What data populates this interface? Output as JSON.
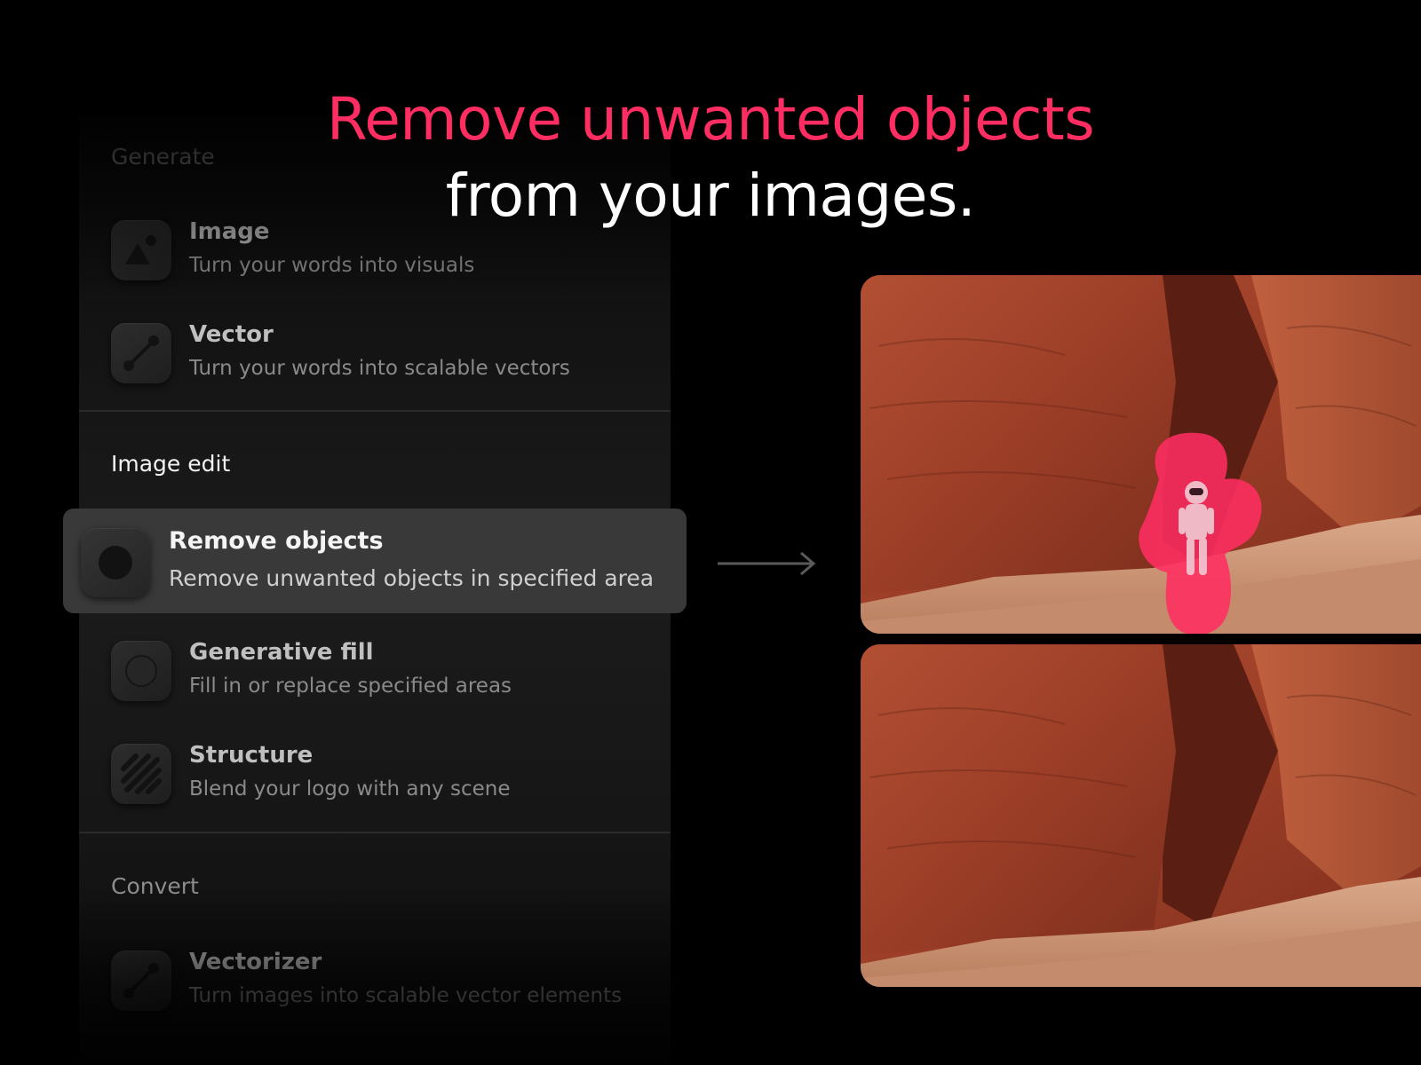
{
  "headline": {
    "line1": "Remove unwanted objects",
    "line2": "from your images."
  },
  "menu": {
    "sections": [
      {
        "label": "Generate",
        "items": [
          {
            "title": "Image",
            "description": "Turn your words into visuals",
            "icon": "image-icon"
          },
          {
            "title": "Vector",
            "description": "Turn your words into scalable vectors",
            "icon": "vector-pen-icon"
          }
        ]
      },
      {
        "label": "Image edit",
        "items": [
          {
            "title": "Remove objects",
            "description": "Remove unwanted objects in specified area",
            "icon": "remove-objects-icon",
            "selected": true
          },
          {
            "title": "Generative fill",
            "description": "Fill in or replace specified areas",
            "icon": "generative-fill-icon"
          },
          {
            "title": "Structure",
            "description": "Blend your logo with any scene",
            "icon": "structure-stripes-icon"
          }
        ]
      },
      {
        "label": "Convert",
        "items": [
          {
            "title": "Vectorizer",
            "description": "Turn images into scalable vector elements",
            "icon": "vectorizer-icon"
          }
        ]
      }
    ]
  },
  "colors": {
    "accent": "#ff2d61",
    "background": "#000000",
    "selected_item": "#393939",
    "rock": "#a9472e"
  },
  "preview": {
    "before_icon": "astronaut-with-mask",
    "after_icon": "clean-rock-scene"
  }
}
